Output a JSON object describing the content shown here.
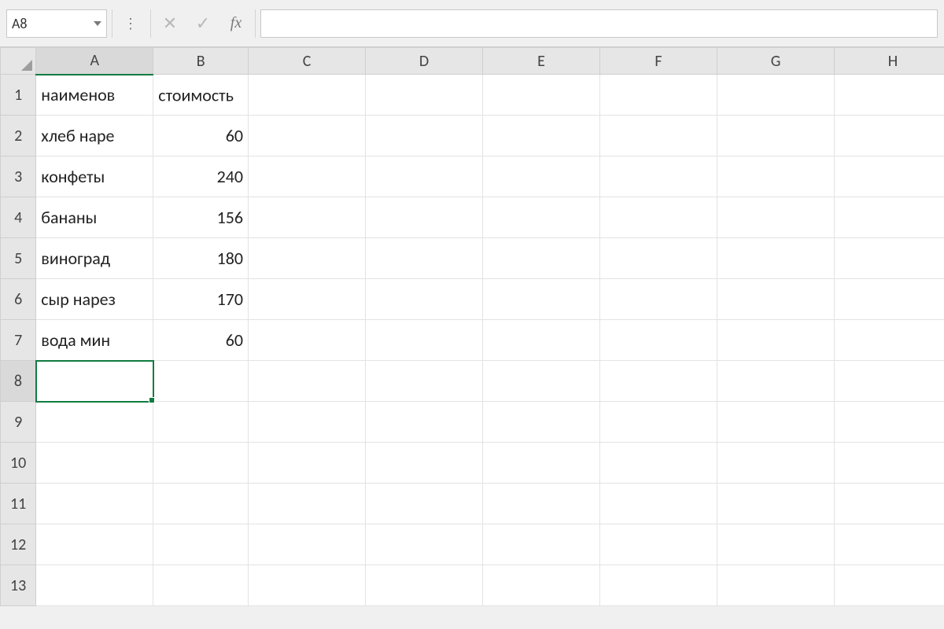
{
  "formula_bar": {
    "name_box": "A8",
    "fx_label": "fx",
    "formula_value": ""
  },
  "columns": [
    "A",
    "B",
    "C",
    "D",
    "E",
    "F",
    "G",
    "H"
  ],
  "active_cell": {
    "col": "A",
    "row": 8
  },
  "visible_rows": 13,
  "cells": {
    "A1": "наименов",
    "B1_overflow": "стоимость",
    "A2": "хлеб наре",
    "B2": "60",
    "A3": "конфеты",
    "B3": "240",
    "A4": "бананы",
    "B4": "156",
    "A5": "виноград",
    "B5": "180",
    "A6": "сыр нарез",
    "B6": "170",
    "A7": "вода мин",
    "B7": "60"
  },
  "row_labels": [
    "1",
    "2",
    "3",
    "4",
    "5",
    "6",
    "7",
    "8",
    "9",
    "10",
    "11",
    "12",
    "13"
  ]
}
